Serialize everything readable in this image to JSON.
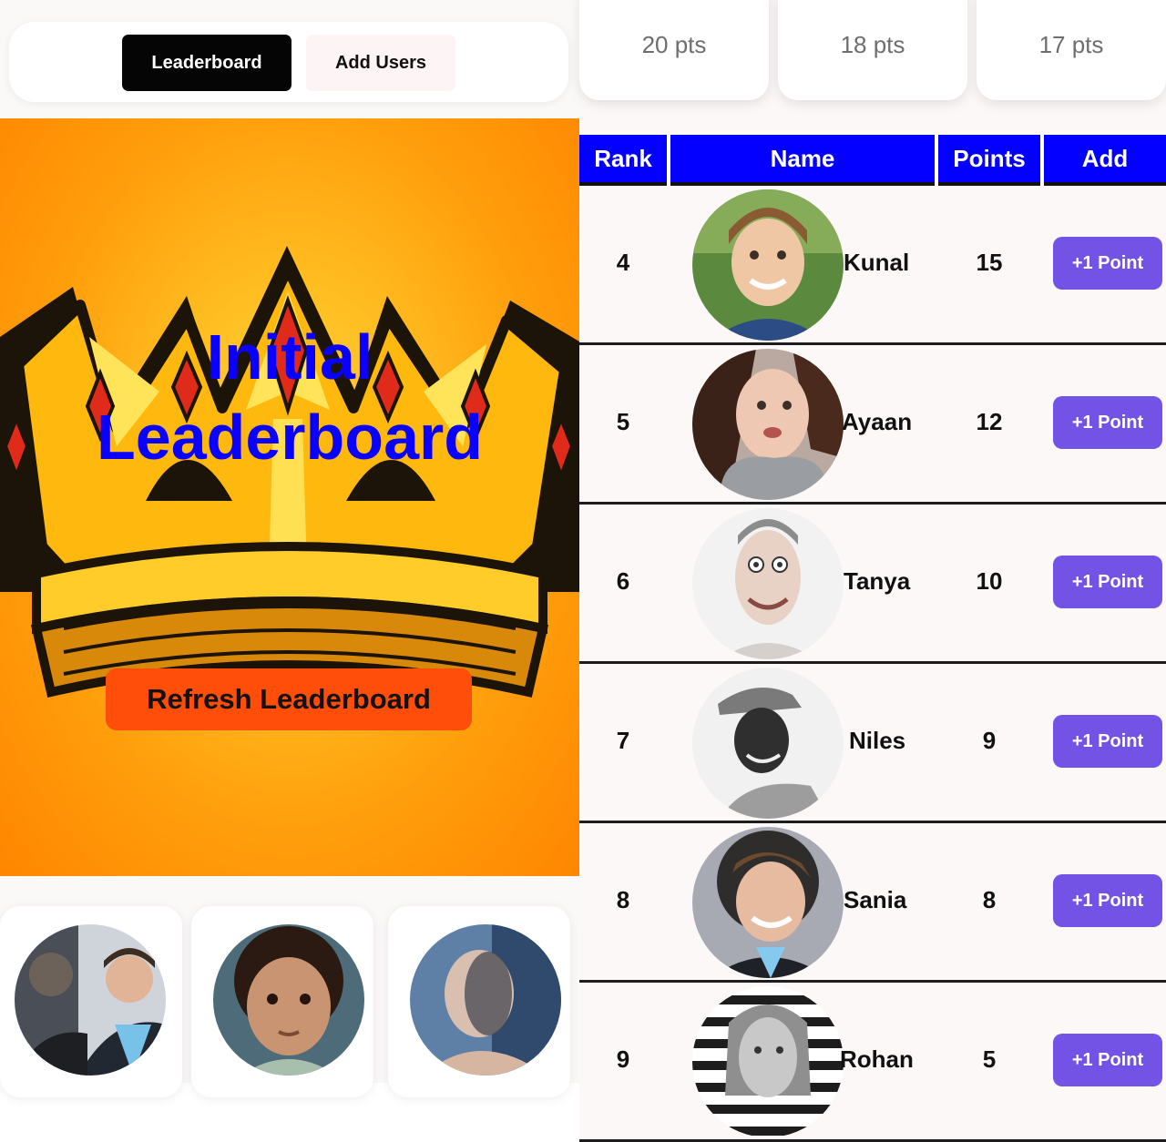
{
  "nav": {
    "tabs": [
      {
        "label": "Leaderboard",
        "active": true
      },
      {
        "label": "Add Users",
        "active": false
      }
    ]
  },
  "hero": {
    "title_line1": "Initial",
    "title_line2": "Leaderboard",
    "refresh_label": "Refresh Leaderboard"
  },
  "top_cards": [
    {
      "points": "20 pts"
    },
    {
      "points": "18 pts"
    },
    {
      "points": "17 pts"
    }
  ],
  "table": {
    "headers": [
      "Rank",
      "Name",
      "Points",
      "Add"
    ],
    "rows": [
      {
        "rank": "4",
        "name": "Kunal",
        "points": "15",
        "button": "+1 Point"
      },
      {
        "rank": "5",
        "name": "Ayaan",
        "points": "12",
        "button": "+1 Point"
      },
      {
        "rank": "6",
        "name": "Tanya",
        "points": "10",
        "button": "+1 Point"
      },
      {
        "rank": "7",
        "name": "Niles",
        "points": "9",
        "button": "+1 Point"
      },
      {
        "rank": "8",
        "name": "Sania",
        "points": "8",
        "button": "+1 Point"
      },
      {
        "rank": "9",
        "name": "Rohan",
        "points": "5",
        "button": "+1 Point"
      }
    ]
  },
  "colors": {
    "header_bg": "#0400ff",
    "add_button": "#7352e6",
    "refresh_button": "#ff4d0a",
    "hero_title": "#0a00ff",
    "active_tab": "#050505"
  }
}
